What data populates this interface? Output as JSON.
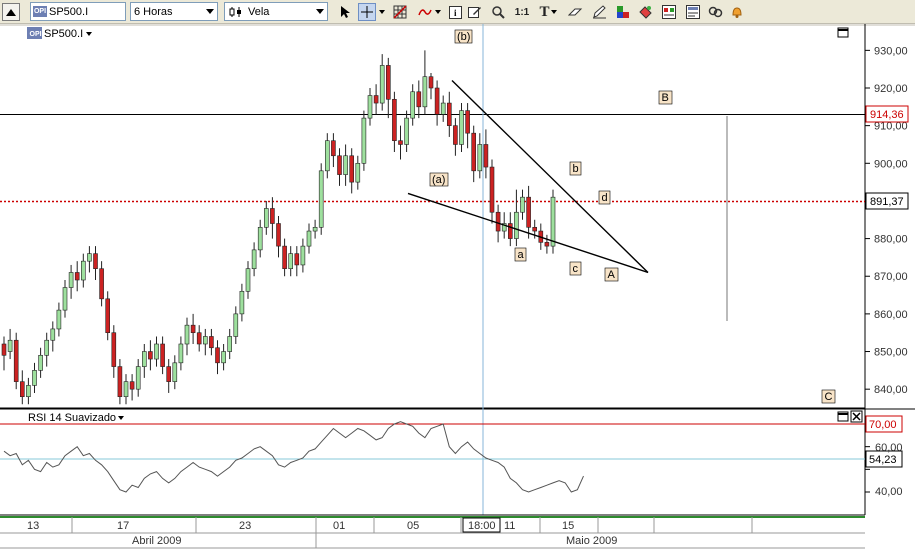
{
  "toolbar": {
    "symbol": "SP500.I",
    "period": "6 Horas",
    "chart_type": "Vela",
    "zoom_ratio": "1:1"
  },
  "chart": {
    "symbol_label": "SP500.I",
    "last_price": "891,37",
    "hline_value": "914,36",
    "price_ticks": [
      "930,00",
      "920,00",
      "910,00",
      "900,00",
      "890,00",
      "880,00",
      "870,00",
      "860,00",
      "850,00",
      "840,00"
    ],
    "wave_labels": {
      "b_paren": "(b)",
      "a_paren": "(a)",
      "b": "b",
      "a": "a",
      "c": "c",
      "d": "d",
      "A": "A",
      "B": "B",
      "C": "C"
    }
  },
  "rsi": {
    "title": "RSI 14 Suavizado",
    "level_high": "70,00",
    "current": "54,23",
    "ticks": [
      "60,00",
      "50,00",
      "40,00"
    ]
  },
  "time_axis": {
    "day_ticks": [
      "13",
      "17",
      "23",
      "01",
      "05",
      "11",
      "15"
    ],
    "crosshair_time": "18:00",
    "months": [
      "Abril 2009",
      "Maio 2009"
    ]
  },
  "colors": {
    "up": "#2e8b2e",
    "down": "#cc2222",
    "accent": "#cc0000",
    "rsi_line": "#555555",
    "crosshair": "#87b5d8"
  },
  "chart_data": {
    "type": "candlestick",
    "yrange": [
      835,
      937
    ],
    "candles": [
      [
        852,
        849,
        845,
        854
      ],
      [
        850,
        853,
        848,
        856
      ],
      [
        853,
        842,
        840,
        855
      ],
      [
        842,
        838,
        836,
        845
      ],
      [
        838,
        841,
        836,
        843
      ],
      [
        841,
        845,
        839,
        847
      ],
      [
        845,
        849,
        843,
        851
      ],
      [
        849,
        853,
        846,
        855
      ],
      [
        853,
        856,
        850,
        858
      ],
      [
        856,
        861,
        854,
        863
      ],
      [
        861,
        867,
        859,
        869
      ],
      [
        867,
        871,
        864,
        873
      ],
      [
        871,
        869,
        866,
        874
      ],
      [
        869,
        874,
        867,
        876
      ],
      [
        874,
        876,
        871,
        878
      ],
      [
        876,
        872,
        869,
        878
      ],
      [
        872,
        864,
        862,
        874
      ],
      [
        864,
        855,
        853,
        866
      ],
      [
        855,
        846,
        843,
        857
      ],
      [
        846,
        838,
        836,
        848
      ],
      [
        838,
        842,
        836,
        844
      ],
      [
        842,
        840,
        837,
        844
      ],
      [
        840,
        846,
        838,
        848
      ],
      [
        846,
        850,
        843,
        852
      ],
      [
        850,
        848,
        845,
        853
      ],
      [
        848,
        852,
        846,
        854
      ],
      [
        852,
        846,
        844,
        854
      ],
      [
        846,
        842,
        839,
        848
      ],
      [
        842,
        847,
        840,
        849
      ],
      [
        847,
        852,
        845,
        854
      ],
      [
        852,
        857,
        849,
        859
      ],
      [
        857,
        855,
        852,
        860
      ],
      [
        855,
        852,
        850,
        857
      ],
      [
        852,
        854,
        849,
        856
      ],
      [
        854,
        851,
        849,
        856
      ],
      [
        851,
        847,
        844,
        853
      ],
      [
        847,
        850,
        845,
        852
      ],
      [
        850,
        854,
        848,
        856
      ],
      [
        854,
        860,
        852,
        862
      ],
      [
        860,
        866,
        858,
        868
      ],
      [
        866,
        872,
        864,
        874
      ],
      [
        872,
        877,
        870,
        879
      ],
      [
        877,
        883,
        875,
        885
      ],
      [
        883,
        888,
        881,
        890
      ],
      [
        888,
        884,
        880,
        891
      ],
      [
        884,
        878,
        875,
        886
      ],
      [
        878,
        872,
        870,
        880
      ],
      [
        872,
        876,
        870,
        878
      ],
      [
        876,
        873,
        870,
        878
      ],
      [
        873,
        878,
        871,
        880
      ],
      [
        878,
        882,
        876,
        884
      ],
      [
        882,
        883,
        880,
        885
      ],
      [
        883,
        898,
        881,
        900
      ],
      [
        898,
        906,
        896,
        908
      ],
      [
        906,
        902,
        899,
        908
      ],
      [
        902,
        897,
        894,
        904
      ],
      [
        897,
        902,
        894,
        905
      ],
      [
        902,
        895,
        892,
        904
      ],
      [
        895,
        900,
        893,
        902
      ],
      [
        900,
        912,
        898,
        914
      ],
      [
        912,
        918,
        910,
        920
      ],
      [
        918,
        916,
        913,
        921
      ],
      [
        916,
        926,
        914,
        929
      ],
      [
        926,
        917,
        912,
        928
      ],
      [
        917,
        906,
        903,
        919
      ],
      [
        906,
        905,
        901,
        910
      ],
      [
        905,
        912,
        903,
        914
      ],
      [
        912,
        919,
        910,
        921
      ],
      [
        919,
        915,
        912,
        922
      ],
      [
        915,
        923,
        913,
        930
      ],
      [
        923,
        920,
        917,
        924
      ],
      [
        920,
        913,
        910,
        922
      ],
      [
        913,
        916,
        911,
        918
      ],
      [
        916,
        910,
        907,
        919
      ],
      [
        910,
        905,
        902,
        912
      ],
      [
        905,
        914,
        903,
        916
      ],
      [
        914,
        908,
        904,
        916
      ],
      [
        908,
        898,
        895,
        910
      ],
      [
        898,
        905,
        896,
        908
      ],
      [
        905,
        899,
        896,
        909
      ],
      [
        899,
        887,
        884,
        901
      ],
      [
        887,
        882,
        879,
        889
      ],
      [
        882,
        884,
        880,
        887
      ],
      [
        884,
        880,
        878,
        887
      ],
      [
        880,
        887,
        878,
        893
      ],
      [
        887,
        891,
        885,
        893
      ],
      [
        891,
        883,
        880,
        894
      ],
      [
        883,
        882,
        880,
        885
      ],
      [
        882,
        879,
        877,
        884
      ],
      [
        879,
        878,
        876,
        881
      ],
      [
        878,
        891,
        876,
        893
      ]
    ],
    "trendlines": [
      {
        "from": [
          452,
          922
        ],
        "to": [
          648,
          871
        ]
      },
      {
        "from": [
          408,
          892
        ],
        "to": [
          648,
          871
        ]
      }
    ],
    "rsi_values": [
      58,
      56,
      57,
      52,
      54,
      50,
      49,
      53,
      51,
      52,
      56,
      58,
      60,
      56,
      57,
      54,
      52,
      49,
      45,
      41,
      40,
      43,
      42,
      46,
      48,
      49,
      46,
      44,
      46,
      49,
      51,
      53,
      51,
      50,
      49,
      47,
      49,
      51,
      54,
      55,
      57,
      59,
      60,
      58,
      56,
      52,
      51,
      53,
      54,
      55,
      58,
      59,
      62,
      65,
      68,
      66,
      64,
      66,
      68,
      67,
      65,
      63,
      64,
      68,
      70,
      71,
      70,
      69,
      66,
      64,
      68,
      69,
      70,
      60,
      57,
      60,
      62,
      59,
      57,
      55,
      54,
      53,
      51,
      46,
      44,
      41,
      40,
      41,
      42,
      43,
      44,
      45,
      44,
      40,
      41,
      47
    ]
  }
}
